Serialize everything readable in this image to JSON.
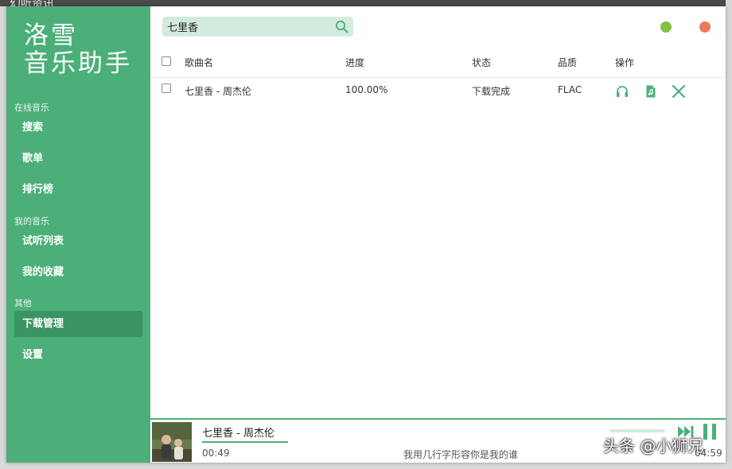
{
  "background": {
    "window_title": "幻听资讯"
  },
  "sidebar": {
    "logo": {
      "line1": "洛雪",
      "line2": "音乐助手"
    },
    "sections": [
      {
        "label": "在线音乐",
        "items": [
          "搜索",
          "歌单",
          "排行榜"
        ]
      },
      {
        "label": "我的音乐",
        "items": [
          "试听列表",
          "我的收藏"
        ]
      },
      {
        "label": "其他",
        "items": [
          "下载管理",
          "设置"
        ]
      }
    ],
    "active_item": "下载管理"
  },
  "search": {
    "value": "七里香",
    "icon": "search-icon"
  },
  "window_controls": {
    "minimize_color": "#82c341",
    "close_color": "#f0775a"
  },
  "table": {
    "columns": [
      "歌曲名",
      "进度",
      "状态",
      "品质",
      "操作"
    ],
    "rows": [
      {
        "title": "七里香 - 周杰伦",
        "progress": "100.00%",
        "status": "下载完成",
        "quality": "FLAC",
        "actions": [
          "headphones-icon",
          "music-file-icon",
          "delete-icon"
        ]
      }
    ]
  },
  "player": {
    "now_playing": "七里香 - 周杰伦",
    "current_time": "00:49",
    "lyric": "我用几行字形容你是我的谁",
    "total_time": "04:59"
  },
  "watermark": "头条 @小狮兄",
  "colors": {
    "accent": "#4caf7a",
    "accent_dark": "#3b9464",
    "accent_light": "#d2ebdd"
  }
}
